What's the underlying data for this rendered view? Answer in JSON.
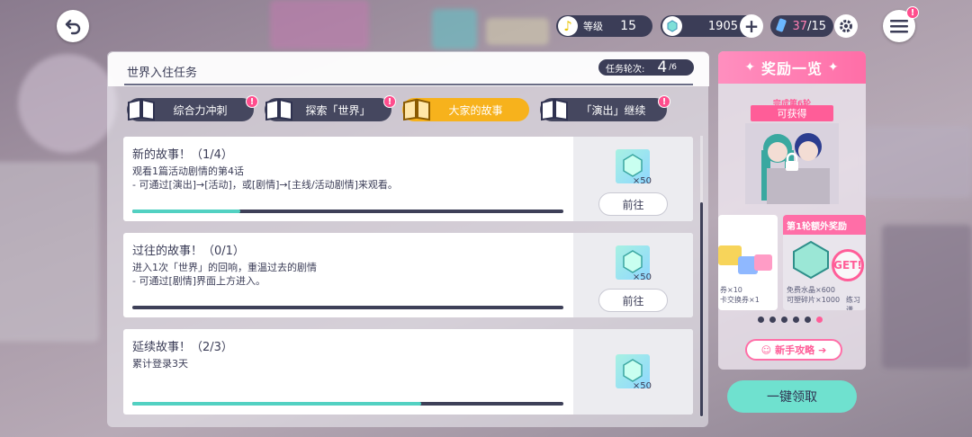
{
  "topbar": {
    "level_label": "等级",
    "level_value": "15",
    "crystals": "1905",
    "stamina_current": "37",
    "stamina_max": "/15"
  },
  "panel": {
    "title": "世界入住任务",
    "round_label": "任务轮次:",
    "round_value": "4",
    "round_total": "/6"
  },
  "tabs": [
    {
      "label": "综合力冲刺",
      "active": false,
      "alert": true
    },
    {
      "label": "探索「世界」",
      "active": false,
      "alert": true
    },
    {
      "label": "大家的故事",
      "active": true,
      "alert": false
    },
    {
      "label": "「演出」继续",
      "active": false,
      "alert": true
    }
  ],
  "tasks": [
    {
      "title": "新的故事！（1/4）",
      "desc1": "观看1篇活动剧情的第4话",
      "desc2": "- 可通过[演出]→[活动]，或[剧情]→[主线/活动剧情]来观看。",
      "progress": 0.25,
      "reward_qty": "×50",
      "button": "前往"
    },
    {
      "title": "过往的故事！（0/1）",
      "desc1": "进入1次「世界」的回响，重温过去的剧情",
      "desc2": "- 可通过[剧情]界面上方进入。",
      "progress": 0.0,
      "reward_qty": "×50",
      "button": "前往"
    },
    {
      "title": "延续故事！（2/3）",
      "desc1": "累计登录3天",
      "desc2": "",
      "progress": 0.67,
      "reward_qty": "×50",
      "button": ""
    }
  ],
  "rewards": {
    "title": "奖励一览",
    "complete_label": "完成第6轮",
    "obtainable": "可获得",
    "bonus_title": "第1轮额外奖励",
    "get_label": "GET!",
    "bonus_line1": "免费水晶×600",
    "bonus_line2": "可塑碎片×1000",
    "side_line1": "练习谱",
    "side_line2": "",
    "left_line1": "券×10",
    "left_line2": "卡交换券×1",
    "guide": "新手攻略",
    "carousel_count": 6,
    "carousel_active": 6
  },
  "claim_all": "一键领取",
  "colors": {
    "accent": "#f7b21c",
    "pink": "#ff6ea7",
    "teal": "#6fe1cf",
    "dark": "#3b3d57"
  }
}
